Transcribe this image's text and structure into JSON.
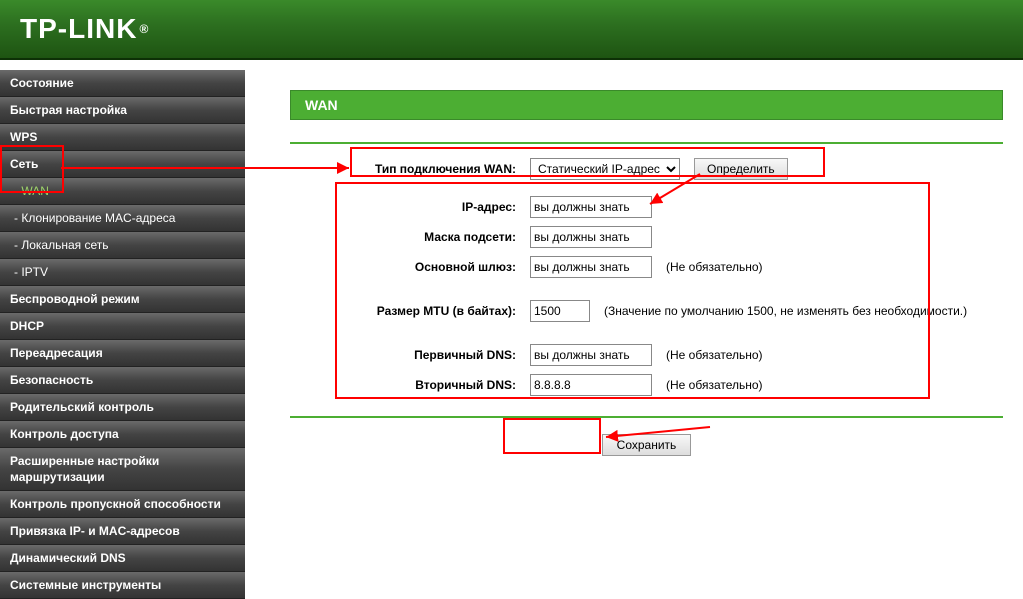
{
  "brand": "TP-LINK",
  "sidebar": {
    "items": [
      {
        "label": "Состояние",
        "sub": false
      },
      {
        "label": "Быстрая настройка",
        "sub": false
      },
      {
        "label": "WPS",
        "sub": false
      },
      {
        "label": "Сеть",
        "sub": false,
        "highlight": "parent"
      },
      {
        "label": "- WAN",
        "sub": true,
        "highlight": "active"
      },
      {
        "label": "- Клонирование MAC-адреса",
        "sub": true
      },
      {
        "label": "- Локальная сеть",
        "sub": true
      },
      {
        "label": "- IPTV",
        "sub": true
      },
      {
        "label": "Беспроводной режим",
        "sub": false
      },
      {
        "label": "DHCP",
        "sub": false
      },
      {
        "label": "Переадресация",
        "sub": false
      },
      {
        "label": "Безопасность",
        "sub": false
      },
      {
        "label": "Родительский контроль",
        "sub": false
      },
      {
        "label": "Контроль доступа",
        "sub": false
      },
      {
        "label": "Расширенные настройки маршрутизации",
        "sub": false
      },
      {
        "label": "Контроль пропускной способности",
        "sub": false
      },
      {
        "label": "Привязка IP- и MAC-адресов",
        "sub": false
      },
      {
        "label": "Динамический DNS",
        "sub": false
      },
      {
        "label": "Системные инструменты",
        "sub": false
      }
    ]
  },
  "page": {
    "title": "WAN",
    "wan_type_label": "Тип подключения WAN:",
    "wan_type_value": "Статический IP-адрес",
    "detect_btn": "Определить",
    "fields": {
      "ip_label": "IP-адрес:",
      "ip_value": "вы должны знать",
      "mask_label": "Маска подсети:",
      "mask_value": "вы должны знать",
      "gw_label": "Основной шлюз:",
      "gw_value": "вы должны знать",
      "gw_note": "(Не обязательно)",
      "mtu_label": "Размер MTU (в байтах):",
      "mtu_value": "1500",
      "mtu_note": "(Значение по умолчанию 1500, не изменять без необходимости.)",
      "dns1_label": "Первичный DNS:",
      "dns1_value": "вы должны знать",
      "dns1_note": "(Не обязательно)",
      "dns2_label": "Вторичный DNS:",
      "dns2_value": "8.8.8.8",
      "dns2_note": "(Не обязательно)"
    },
    "save_btn": "Сохранить"
  },
  "annotations": {
    "color": "#ff0000"
  }
}
